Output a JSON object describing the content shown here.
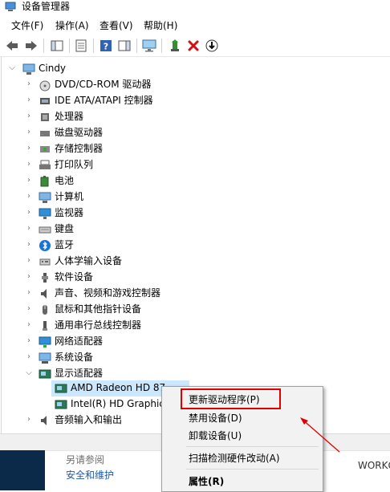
{
  "window": {
    "title": "设备管理器"
  },
  "menu": [
    "文件(F)",
    "操作(A)",
    "查看(V)",
    "帮助(H)"
  ],
  "toolbar": [
    "back-icon",
    "forward-icon",
    "console-tree-icon",
    "properties-icon",
    "help-icon",
    "action-pane-icon",
    "monitor-icon",
    "update-driver-icon",
    "uninstall-icon",
    "download-icon"
  ],
  "tree": {
    "root": "Cindy",
    "categories": [
      {
        "label": "DVD/CD-ROM 驱动器",
        "icon": "dvd-icon"
      },
      {
        "label": "IDE ATA/ATAPI 控制器",
        "icon": "ide-icon"
      },
      {
        "label": "处理器",
        "icon": "processor-icon"
      },
      {
        "label": "磁盘驱动器",
        "icon": "disk-icon"
      },
      {
        "label": "存储控制器",
        "icon": "storage-icon"
      },
      {
        "label": "打印队列",
        "icon": "printer-icon"
      },
      {
        "label": "电池",
        "icon": "battery-icon"
      },
      {
        "label": "计算机",
        "icon": "computer-icon"
      },
      {
        "label": "监视器",
        "icon": "monitor-icon"
      },
      {
        "label": "键盘",
        "icon": "keyboard-icon"
      },
      {
        "label": "蓝牙",
        "icon": "bluetooth-icon"
      },
      {
        "label": "人体学输入设备",
        "icon": "hid-icon"
      },
      {
        "label": "软件设备",
        "icon": "software-icon"
      },
      {
        "label": "声音、视频和游戏控制器",
        "icon": "sound-icon"
      },
      {
        "label": "鼠标和其他指针设备",
        "icon": "mouse-icon"
      },
      {
        "label": "通用串行总线控制器",
        "icon": "usb-icon"
      },
      {
        "label": "网络适配器",
        "icon": "network-icon"
      },
      {
        "label": "系统设备",
        "icon": "system-icon"
      },
      {
        "label": "显示适配器",
        "icon": "display-icon"
      }
    ],
    "display_children": [
      "AMD Radeon HD 87",
      "Intel(R) HD Graphic"
    ],
    "after": {
      "label": "音频输入和输出",
      "icon": "audio-icon"
    }
  },
  "context_menu": {
    "items": [
      "更新驱动程序(P)",
      "禁用设备(D)",
      "卸载设备(U)",
      "扫描检测硬件改动(A)",
      "属性(R)"
    ]
  },
  "bottom": {
    "related": "另请参阅",
    "safety": "安全和维护",
    "workgroup": "WORKG"
  },
  "colors": {
    "highlight": "#e00000",
    "selection": "#cce8ff"
  }
}
